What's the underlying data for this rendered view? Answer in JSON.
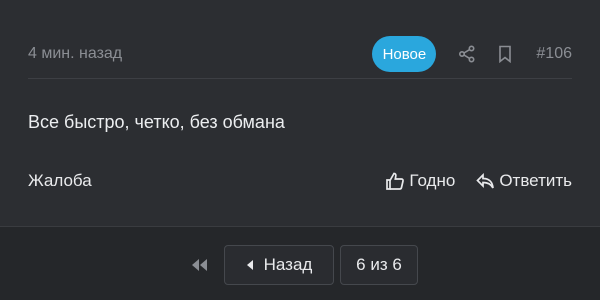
{
  "comment": {
    "timestamp": "4 мин. назад",
    "badge": "Новое",
    "post_id": "#106",
    "text": "Все быстро, четко, без обмана",
    "report_label": "Жалоба",
    "like_label": "Годно",
    "reply_label": "Ответить"
  },
  "pagination": {
    "back_label": "Назад",
    "page_info": "6 из 6"
  },
  "colors": {
    "background": "#2c2e32",
    "footer": "#25272a",
    "badge": "#2aa7dd",
    "muted_text": "#8b8e94"
  },
  "icons": [
    "share-icon",
    "bookmark-icon",
    "thumbs-up-icon",
    "reply-icon",
    "double-chevron-left-icon",
    "caret-left-icon"
  ]
}
